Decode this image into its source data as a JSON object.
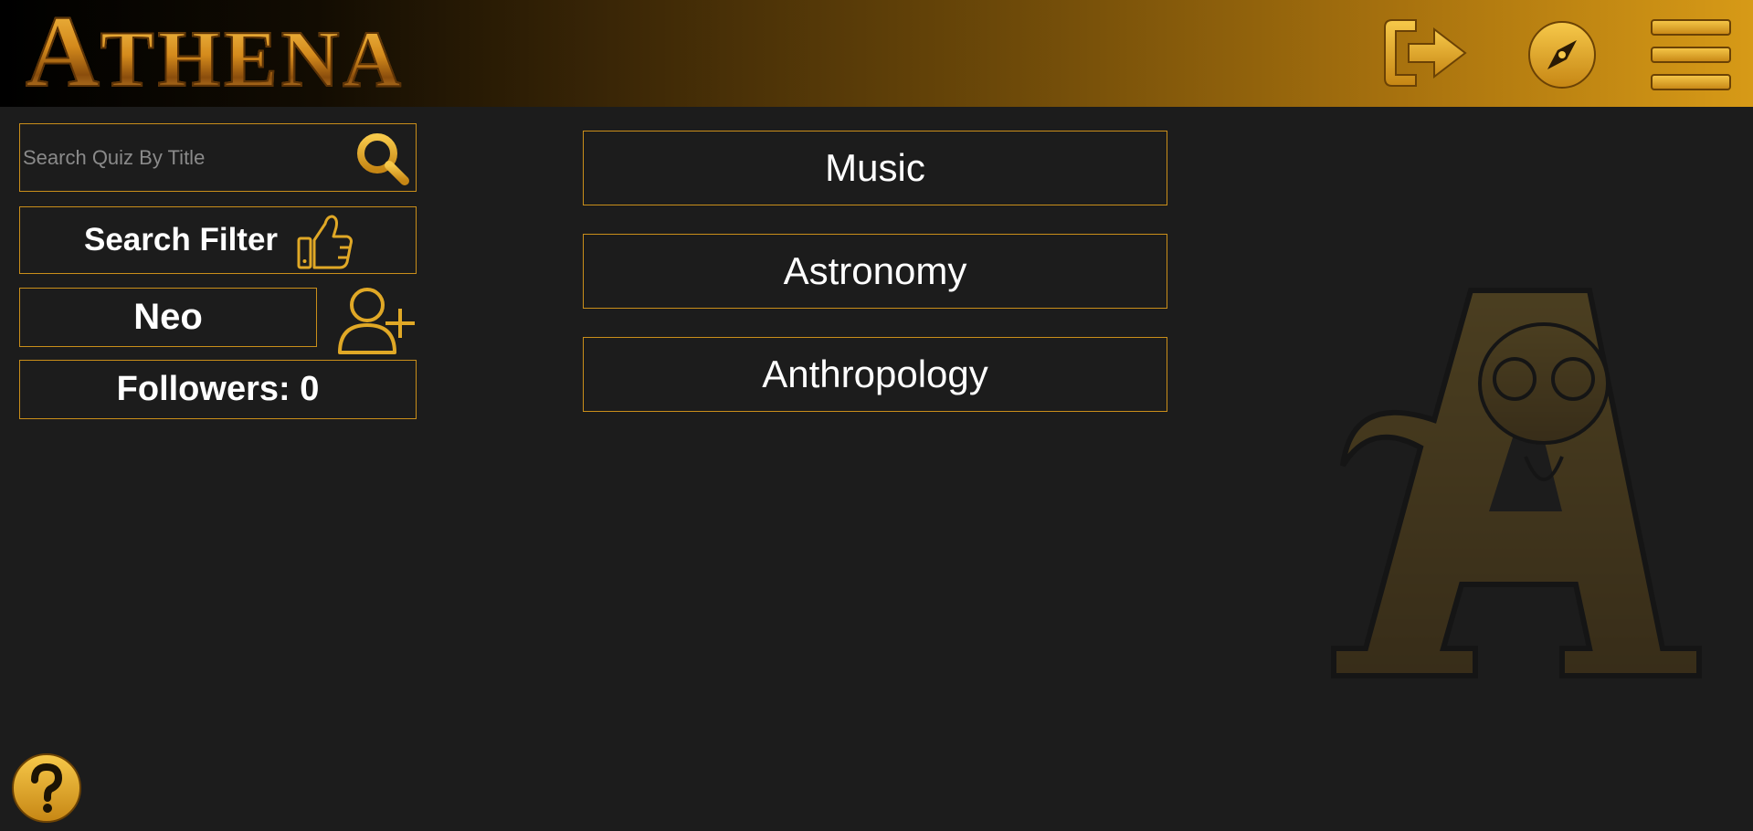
{
  "app": {
    "logo_first": "A",
    "logo_rest": "THENA"
  },
  "header": {
    "icons": [
      "logout-icon",
      "compass-icon",
      "menu-icon"
    ]
  },
  "sidebar": {
    "search_placeholder": "Search Quiz By Title",
    "search_value": "",
    "filter_label": "Search Filter",
    "username": "Neo",
    "followers_label": "Followers: 0"
  },
  "categories": [
    {
      "label": "Music"
    },
    {
      "label": "Astronomy"
    },
    {
      "label": "Anthropology"
    }
  ],
  "colors": {
    "accent": "#c98e1a",
    "gold": "#e0a826",
    "background": "#1c1c1c",
    "text": "#ffffff"
  }
}
